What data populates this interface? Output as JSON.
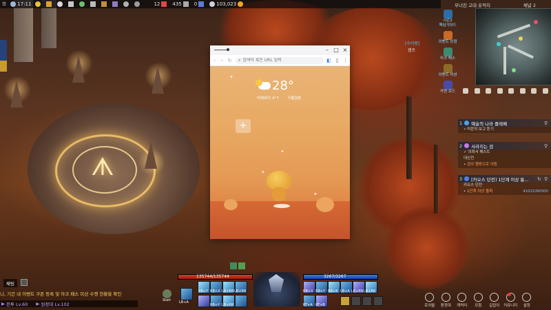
{
  "topbar": {
    "time": "17:11",
    "val1": "12",
    "val2": "435",
    "val3": "0",
    "gold": "103,023"
  },
  "browser": {
    "url_placeholder": "검색어 혹은 URL 입력",
    "temperature": "28°",
    "weather_left": "어제보다 4°↑",
    "weather_right": "구름많음",
    "shortcut_add": "+"
  },
  "area": {
    "name": "무너진 고대 유적지",
    "channel": "채널 2"
  },
  "left_icons": [
    {
      "label": "시즌2\n핵심가이드",
      "color": "#2d6ea8"
    },
    {
      "label": "이벤트 상점",
      "color": "#c86a2a"
    },
    {
      "label": "아크 패스",
      "color": "#3d8a6e"
    },
    {
      "label": "이벤트 미션",
      "color": "#8e6a28"
    },
    {
      "label": "카멘 로드",
      "color": "#4a4aa8"
    }
  ],
  "side_tags": {
    "repair": "[수리중]",
    "camp": "캠프"
  },
  "quests": [
    {
      "num": "1",
      "title": "예술의 나라 플레체",
      "lines": [
        {
          "pre": "• ",
          "text": "미란의 보고 듣기",
          "style": ""
        }
      ],
      "icon": "#4fa3e8"
    },
    {
      "num": "2",
      "title": "사라지는 검",
      "lines": [
        {
          "pre": "",
          "text": "✓ 의뢰서 퀘스트",
          "style": ""
        },
        {
          "pre": "",
          "text": "대신전",
          "style": ""
        },
        {
          "pre": "• ",
          "text": "검의 행방으로 이동",
          "style": "hl"
        }
      ],
      "icon": "#c878e8"
    },
    {
      "num": "3",
      "title": "[카오스 던전] 1단계 이상 통...",
      "lines": [
        {
          "pre": "",
          "text": "카오스 던전",
          "style": ""
        },
        {
          "pre": "• ",
          "text": "1단계 이상 돌파",
          "style": "hl"
        },
        {
          "pre": "",
          "text": "41022/60000",
          "style": "blue"
        }
      ],
      "icon": "#4f7fe8"
    }
  ],
  "chat": {
    "tab": "채팅",
    "message": "니, 기간 내 이벤트 쿠폰 등록 및 아크 패스 미션 수행 현황을 확인",
    "line2_left": "전투 Lv.60",
    "line2_right": "원정대 Lv.102"
  },
  "bars": {
    "hp": "135744/135744",
    "hp_fraction": 1.0,
    "mp": "3267/3267",
    "mp_fraction": 1.0
  },
  "start_label": "Start",
  "hotkeys_left": [
    "LB+A",
    "RB+Y",
    "RB+X",
    "LB+RB",
    "LB+RB",
    "RB+Y",
    "LB+RB"
  ],
  "hotkeys_right": [
    "RB+X",
    "RB+Y",
    "RB+B",
    "LB+A",
    "LB+RB",
    "LB+RB",
    "RT+A",
    "RT+B"
  ],
  "bottom_menu": [
    {
      "label": "로야랄",
      "icon": "shop-icon"
    },
    {
      "label": "원정대",
      "icon": "guild-icon"
    },
    {
      "label": "캐릭터",
      "icon": "character-icon"
    },
    {
      "label": "모험",
      "icon": "adventure-icon"
    },
    {
      "label": "길잡이",
      "icon": "compass-icon"
    },
    {
      "label": "커뮤니티",
      "icon": "community-icon"
    },
    {
      "label": "설정",
      "icon": "settings-icon"
    }
  ]
}
